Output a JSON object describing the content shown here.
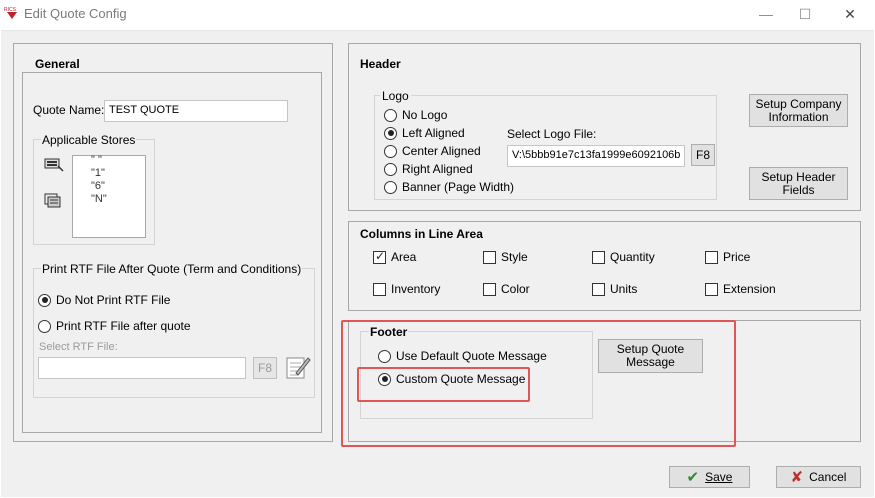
{
  "window": {
    "title": "Edit Quote Config",
    "logo_text": "RICS",
    "minimize": "—",
    "maximize": "☐",
    "close": "✕"
  },
  "general": {
    "title": "General",
    "quote_name_label": "Quote Name:",
    "quote_name_value": "TEST QUOTE",
    "applicable_stores_label": "Applicable Stores",
    "stores": [
      "\" \"",
      "\"1\"",
      "\"6\"",
      "\"N\""
    ]
  },
  "print_rtf": {
    "title": "Print RTF File After Quote (Term and Conditions)",
    "options": [
      {
        "label": "Do Not Print RTF File",
        "selected": true
      },
      {
        "label": "Print RTF File after quote",
        "selected": false
      }
    ],
    "select_label": "Select RTF File:",
    "file_value": "",
    "f8_label": "F8"
  },
  "header": {
    "title": "Header",
    "logo_title": "Logo",
    "logo_options": [
      {
        "label": "No Logo",
        "selected": false
      },
      {
        "label": "Left Aligned",
        "selected": true
      },
      {
        "label": "Center Aligned",
        "selected": false
      },
      {
        "label": "Right Aligned",
        "selected": false
      },
      {
        "label": "Banner (Page Width)",
        "selected": false
      }
    ],
    "select_logo_label": "Select Logo File:",
    "logo_file_value": "V:\\5bbb91e7c13fa1999e6092106b",
    "f8_label": "F8",
    "setup_company_label": "Setup Company Information",
    "setup_header_label": "Setup Header Fields"
  },
  "columns": {
    "title": "Columns in Line Area",
    "items": [
      {
        "label": "Area",
        "checked": true
      },
      {
        "label": "Style",
        "checked": false
      },
      {
        "label": "Quantity",
        "checked": false
      },
      {
        "label": "Price",
        "checked": false
      },
      {
        "label": "Inventory",
        "checked": false
      },
      {
        "label": "Color",
        "checked": false
      },
      {
        "label": "Units",
        "checked": false
      },
      {
        "label": "Extension",
        "checked": false
      }
    ]
  },
  "footer": {
    "title": "Footer",
    "options": [
      {
        "label": "Use Default Quote Message",
        "selected": false
      },
      {
        "label": "Custom Quote Message",
        "selected": true
      }
    ],
    "setup_label": "Setup Quote Message"
  },
  "actions": {
    "save_label": "Save",
    "cancel_label": "Cancel"
  },
  "colors": {
    "highlight": "#e05555",
    "save_check": "#2e8b2e",
    "cancel_x": "#c0302a",
    "logo_red": "#c0202a"
  }
}
